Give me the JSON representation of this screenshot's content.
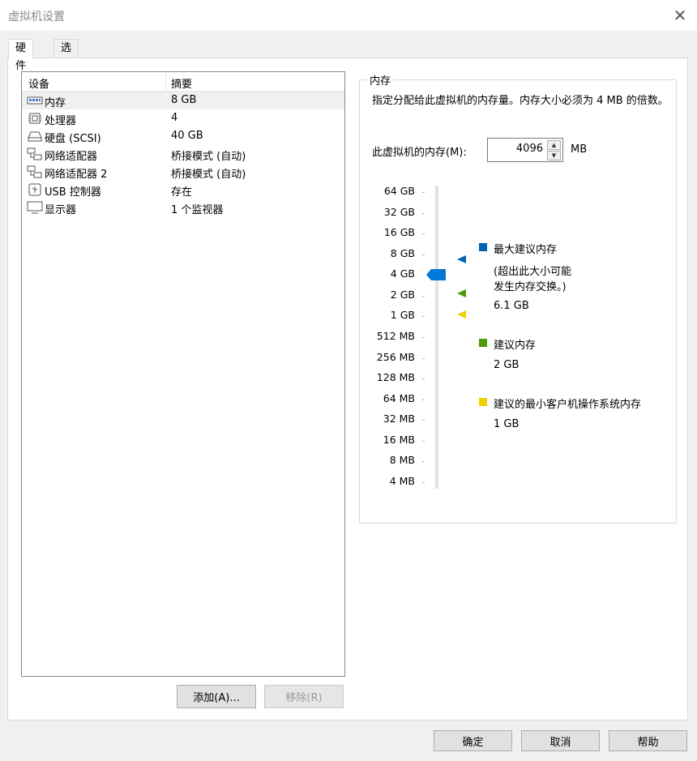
{
  "window": {
    "title": "虚拟机设置",
    "close_glyph": "✕"
  },
  "tabs": [
    {
      "label": "硬件"
    },
    {
      "label": "选项"
    }
  ],
  "device_list": {
    "header_device": "设备",
    "header_summary": "摘要",
    "rows": [
      {
        "name": "内存",
        "summary": "8 GB",
        "icon": "memory-icon",
        "selected": true
      },
      {
        "name": "处理器",
        "summary": "4",
        "icon": "processor-icon"
      },
      {
        "name": "硬盘 (SCSI)",
        "summary": "40 GB",
        "icon": "hard-disk-icon"
      },
      {
        "name": "网络适配器",
        "summary": "桥接模式 (自动)",
        "icon": "network-adapter-icon"
      },
      {
        "name": "网络适配器 2",
        "summary": "桥接模式 (自动)",
        "icon": "network-adapter-icon"
      },
      {
        "name": "USB 控制器",
        "summary": "存在",
        "icon": "usb-icon"
      },
      {
        "name": "显示器",
        "summary": "1 个监视器",
        "icon": "monitor-icon"
      }
    ]
  },
  "list_buttons": {
    "add": "添加(A)...",
    "remove": "移除(R)"
  },
  "memory": {
    "group_title": "内存",
    "description": "指定分配给此虚拟机的内存量。内存大小必须为 4 MB 的倍数。",
    "field_label": "此虚拟机的内存(M):",
    "value": "4096",
    "unit": "MB",
    "scale_labels": [
      "64 GB",
      "32 GB",
      "16 GB",
      "8 GB",
      "4 GB",
      "2 GB",
      "1 GB",
      "512 MB",
      "256 MB",
      "128 MB",
      "64 MB",
      "32 MB",
      "16 MB",
      "8 MB",
      "4 MB"
    ],
    "slider_level": "4 GB",
    "legend": {
      "max_title": "最大建议内存",
      "max_note_line1": "(超出此大小可能",
      "max_note_line2": "发生内存交换。)",
      "max_value": "6.1 GB",
      "recommended_title": "建议内存",
      "recommended_value": "2 GB",
      "min_title": "建议的最小客户机操作系统内存",
      "min_value": "1 GB"
    },
    "colors": {
      "max": "#0063b1",
      "recommended": "#4e9a06",
      "min": "#f0d000",
      "thumb": "#0078d7"
    }
  },
  "footer": {
    "ok": "确定",
    "cancel": "取消",
    "help": "帮助"
  }
}
